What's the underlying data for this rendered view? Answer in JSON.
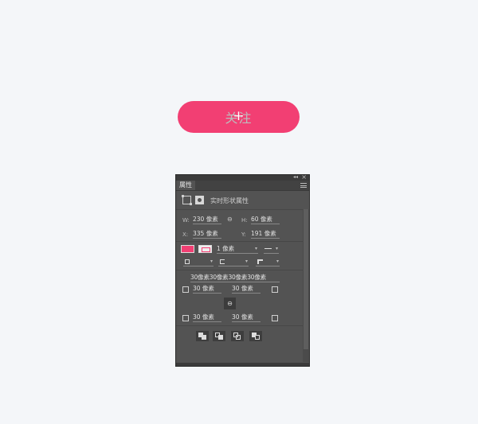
{
  "follow_button": {
    "plus": "+",
    "label": "关注"
  },
  "panel": {
    "tab": "属性",
    "header_label": "实时形状属性",
    "width_label": "W:",
    "width_value": "230 像素",
    "height_label": "H:",
    "height_value": "60 像素",
    "x_label": "X:",
    "x_value": "335 像素",
    "y_label": "Y:",
    "y_value": "191 像素",
    "stroke_width": "1 像素",
    "corners_all": "30像素30像素30像素30像素",
    "corner_tl": "30 像素",
    "corner_tr": "30 像素",
    "corner_bl": "30 像素",
    "corner_br": "30 像素",
    "fill_color": "#f23f73"
  }
}
